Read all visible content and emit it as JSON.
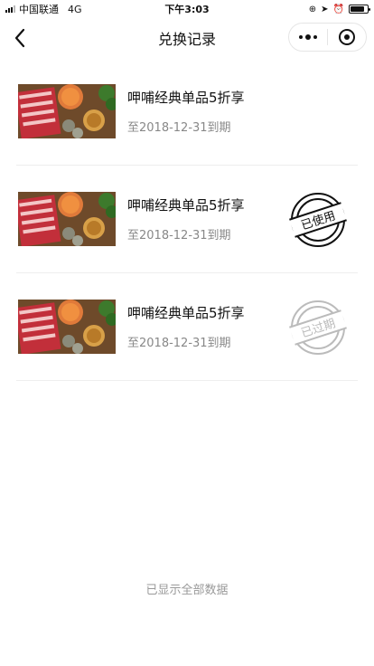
{
  "status_bar": {
    "carrier": "中国联通",
    "network": "4G",
    "time": "下午3:03"
  },
  "nav": {
    "title": "兑换记录"
  },
  "records": [
    {
      "title": "呷哺经典单品5折享",
      "expire": "至2018-12-31到期",
      "stamp": "",
      "image": "hotpot-photo"
    },
    {
      "title": "呷哺经典单品5折享",
      "expire": "至2018-12-31到期",
      "stamp": "已使用",
      "stamp_color": "#111111",
      "image": "hotpot-photo"
    },
    {
      "title": "呷哺经典单品5折享",
      "expire": "至2018-12-31到期",
      "stamp": "已过期",
      "stamp_color": "#bbbbbb",
      "image": "hotpot-photo"
    }
  ],
  "footer": {
    "text": "已显示全部数据"
  },
  "colors": {
    "text_primary": "#111111",
    "text_secondary": "#888888",
    "footer_text": "#999999",
    "divider": "#eeeeee"
  }
}
